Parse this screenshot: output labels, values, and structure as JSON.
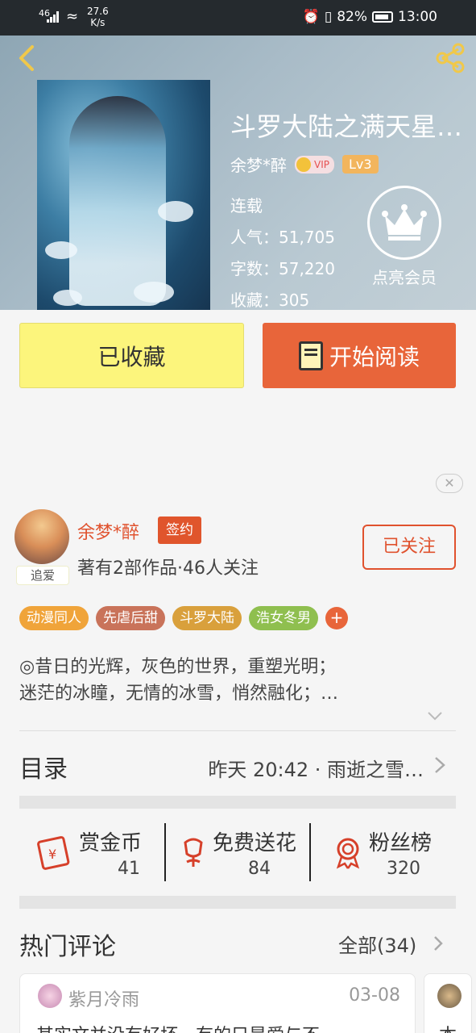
{
  "status_bar": {
    "signal": "46",
    "speed_value": "27.6",
    "speed_unit": "K/s",
    "battery": "82%",
    "time": "13:00"
  },
  "book": {
    "title": "斗罗大陆之满天星…",
    "author": "余梦*醉",
    "vip_label": "VIP",
    "level": "Lv3",
    "status": "连载",
    "popularity": "人气：51,705",
    "word_count": "字数：57,220",
    "favorites": "收藏：305",
    "member_label": "点亮会员"
  },
  "actions": {
    "favorited_label": "已收藏",
    "read_label": "开始阅读"
  },
  "ad": {
    "close_glyph": "✕"
  },
  "author_section": {
    "name": "余梦*醉",
    "signed_badge": "签约",
    "avatar_tag": "追爱",
    "stats": "著有2部作品·46人关注",
    "follow_label": "已关注"
  },
  "tags": [
    {
      "label": "动漫同人",
      "color": "#f0a43a"
    },
    {
      "label": "先虐后甜",
      "color": "#c9735a"
    },
    {
      "label": "斗罗大陆",
      "color": "#d9a03c"
    },
    {
      "label": "浩女冬男",
      "color": "#8fbf4f"
    }
  ],
  "tag_more": "+",
  "description": {
    "line1": "◎昔日的光辉，灰色的世界，重塑光明；",
    "line2": "迷茫的冰瞳，无情的冰雪，悄然融化；…"
  },
  "toc": {
    "title": "目录",
    "update": "昨天 20:42 · 雨逝之雪…"
  },
  "stats": [
    {
      "label": "赏金币",
      "value": "41",
      "icon": "red-envelope-icon"
    },
    {
      "label": "免费送花",
      "value": "84",
      "icon": "flower-icon"
    },
    {
      "label": "粉丝榜",
      "value": "320",
      "icon": "medal-icon"
    }
  ],
  "comments": {
    "title": "热门评论",
    "all_label": "全部(34)",
    "items": [
      {
        "user": "紫月冷雨",
        "date": "03-08",
        "text": "其实文并没有好坏，有的只是爱与不"
      },
      {
        "text": "本"
      }
    ]
  },
  "colors": {
    "accent": "#e8653a",
    "favorite_bg": "#fcf57c",
    "author_red": "#e0522e"
  }
}
